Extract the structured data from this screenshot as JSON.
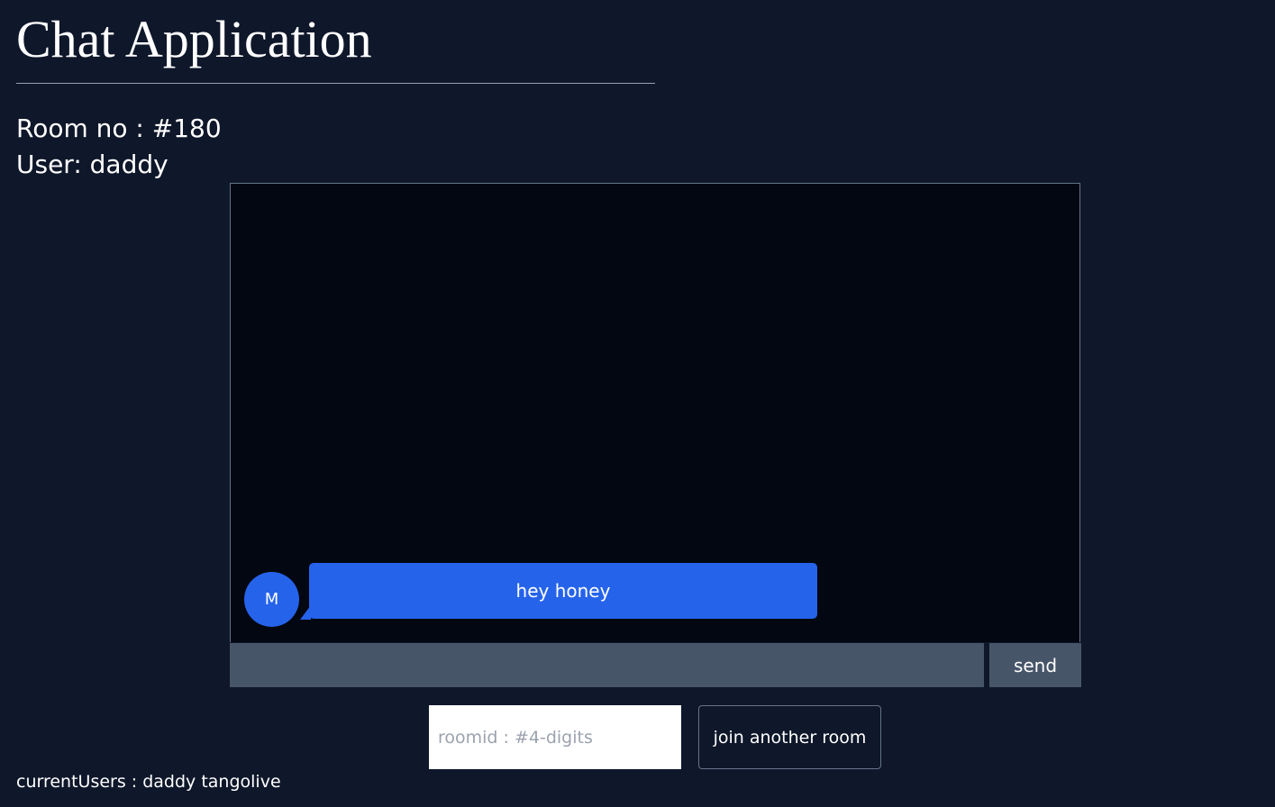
{
  "app": {
    "title": "Chat Application"
  },
  "room": {
    "label": "Room no : #180",
    "user_label": "User: daddy"
  },
  "messages": [
    {
      "avatar_initial": "M",
      "text": "hey honey"
    }
  ],
  "composer": {
    "value": "",
    "send_label": "send"
  },
  "join": {
    "placeholder": "roomid : #4-digits",
    "value": "",
    "button_label": "join another room"
  },
  "footer": {
    "current_users": "currentUsers : daddy tangolive"
  },
  "colors": {
    "background": "#0f172a",
    "chat_background": "#030712",
    "accent": "#2563eb",
    "input_background": "#475569"
  },
  "icons": {
    "avatar": "letter-avatar"
  }
}
